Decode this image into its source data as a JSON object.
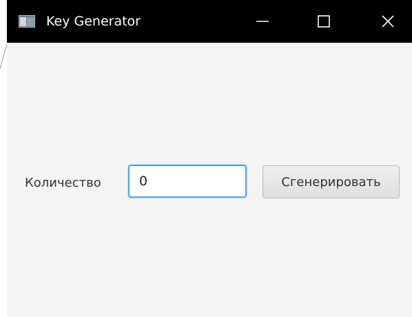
{
  "window": {
    "title": "Key Generator",
    "icons": {
      "app": "app-window-icon",
      "minimize": "minimize-icon",
      "maximize": "maximize-icon",
      "close": "close-icon"
    }
  },
  "form": {
    "quantity_label": "Количество",
    "quantity_value": "0",
    "generate_label": "Сгенерировать"
  },
  "colors": {
    "titlebar": "#000000",
    "background": "#f4f4f4",
    "focus_border": "#4fa3dd"
  }
}
